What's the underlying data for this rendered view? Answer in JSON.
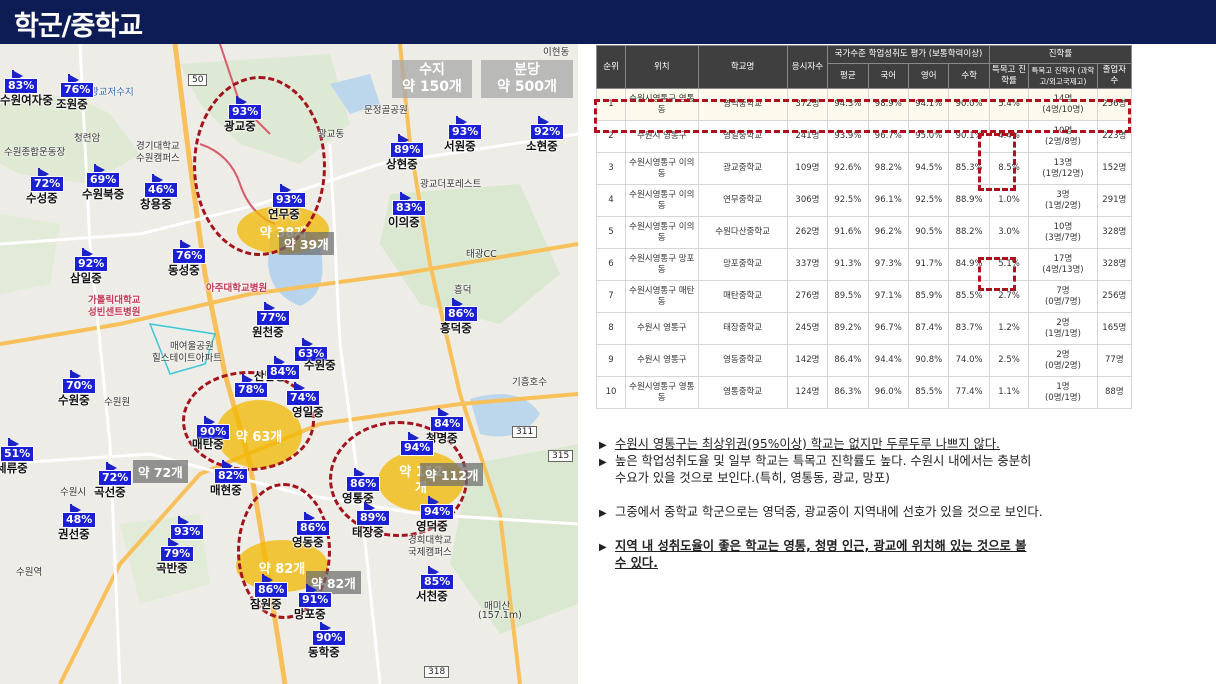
{
  "page": {
    "title": "학군/중학교"
  },
  "map": {
    "gray_counts": [
      {
        "id": "suji",
        "line1": "수지",
        "line2": "약 150개"
      },
      {
        "id": "bundang",
        "line1": "분당",
        "line2": "약 500개"
      },
      {
        "id": "c1",
        "text": "약 39개"
      },
      {
        "id": "c2",
        "text": "약 72개"
      },
      {
        "id": "c3",
        "text": "약 112개"
      },
      {
        "id": "c4",
        "text": "약 82개"
      }
    ],
    "blobs": [
      {
        "id": "b1",
        "text": "약 38개"
      },
      {
        "id": "b2",
        "text": "약 63개"
      },
      {
        "id": "b3",
        "line1": "약 112",
        "line2": "개"
      },
      {
        "id": "b4",
        "text": "약 82개"
      }
    ],
    "pins": [
      {
        "pct": "83%",
        "name": "수원여자중"
      },
      {
        "pct": "76%",
        "name": "조원중"
      },
      {
        "pct": "93%",
        "name": "광교중"
      },
      {
        "pct": "93%",
        "name": "서원중"
      },
      {
        "pct": "92%",
        "name": "소현중"
      },
      {
        "pct": "89%",
        "name": "상현중"
      },
      {
        "pct": "72%",
        "name": "수성중"
      },
      {
        "pct": "69%",
        "name": "수원북중"
      },
      {
        "pct": "46%",
        "name": "창용중"
      },
      {
        "pct": "93%",
        "name": "연무중"
      },
      {
        "pct": "83%",
        "name": "이의중"
      },
      {
        "pct": "92%",
        "name": "삼일중"
      },
      {
        "pct": "76%",
        "name": "동성중"
      },
      {
        "pct": "77%",
        "name": "원천중"
      },
      {
        "pct": "86%",
        "name": "흥덕중"
      },
      {
        "pct": "63%",
        "name": "수원중"
      },
      {
        "pct": "70%",
        "name": "수원중"
      },
      {
        "pct": "78%",
        "name": "산남중"
      },
      {
        "pct": "84%",
        "name": ""
      },
      {
        "pct": "74%",
        "name": "영일중"
      },
      {
        "pct": "90%",
        "name": "매탄중"
      },
      {
        "pct": "84%",
        "name": "청명중"
      },
      {
        "pct": "51%",
        "name": "세류중"
      },
      {
        "pct": "94%",
        "name": ""
      },
      {
        "pct": "72%",
        "name": "곡선중"
      },
      {
        "pct": "82%",
        "name": "매현중"
      },
      {
        "pct": "86%",
        "name": "영통중"
      },
      {
        "pct": "89%",
        "name": "태장중"
      },
      {
        "pct": "94%",
        "name": "영덕중"
      },
      {
        "pct": "48%",
        "name": "권선중"
      },
      {
        "pct": "93%",
        "name": ""
      },
      {
        "pct": "79%",
        "name": "곡반중"
      },
      {
        "pct": "86%",
        "name": "영동중"
      },
      {
        "pct": "85%",
        "name": "서천중"
      },
      {
        "pct": "86%",
        "name": "잠원중"
      },
      {
        "pct": "91%",
        "name": "망포중"
      },
      {
        "pct": "90%",
        "name": "동학중"
      }
    ],
    "labels": [
      {
        "id": "l1",
        "text": "경기대학교"
      },
      {
        "id": "l2",
        "text": "수원캠퍼스"
      },
      {
        "id": "l3",
        "text": "수원종합운동장"
      },
      {
        "id": "l4",
        "text": "청련암"
      },
      {
        "id": "l5",
        "text": "광교저수지"
      },
      {
        "id": "l6",
        "text": "광교동"
      },
      {
        "id": "l7",
        "text": "광교더포레스트"
      },
      {
        "id": "l8",
        "text": "태광CC"
      },
      {
        "id": "l9",
        "text": "가톨릭대학교"
      },
      {
        "id": "l10",
        "text": "성빈센트병원"
      },
      {
        "id": "l11",
        "text": "아주대학교병원"
      },
      {
        "id": "l12",
        "text": "매여울공원"
      },
      {
        "id": "l13",
        "text": "힐스테이트아파트"
      },
      {
        "id": "l14",
        "text": "경희대학교"
      },
      {
        "id": "l15",
        "text": "국제캠퍼스"
      },
      {
        "id": "l16",
        "text": "매미산"
      },
      {
        "id": "l17",
        "text": "(157.1m)"
      },
      {
        "id": "l18",
        "text": "수원시"
      },
      {
        "id": "l19",
        "text": "수원역"
      },
      {
        "id": "l20",
        "text": "수원원"
      },
      {
        "id": "l21",
        "text": "기흥호수"
      },
      {
        "id": "l22",
        "text": "흥덕"
      },
      {
        "id": "l23",
        "text": "이현동"
      },
      {
        "id": "l24",
        "text": "문정골공원"
      },
      {
        "id": "l25",
        "text": "315"
      },
      {
        "id": "l26",
        "text": "311"
      },
      {
        "id": "l27",
        "text": "318"
      },
      {
        "id": "l28",
        "text": "50"
      }
    ]
  },
  "table": {
    "headers": {
      "rank": "순위",
      "location": "위치",
      "school": "학교명",
      "applicants": "응시자수",
      "national_group": "국가수준 학업성취도 평가 (보통학력이상)",
      "avg": "평균",
      "korean": "국어",
      "english": "영어",
      "math": "수학",
      "advance_group": "진학률",
      "special_rate": "특목고 진학률",
      "special_count": "특목고 진학자 (과학고/외고국제고)",
      "grad": "졸업자 수"
    },
    "rows": [
      {
        "rank": "1",
        "loc": "수원시영통구 영통동",
        "school": "영덕중학교",
        "app": "372명",
        "avg": "94.3%",
        "kor": "98.9%",
        "eng": "94.1%",
        "math": "90.0%",
        "rate": "5.4%",
        "cnt1": "14명",
        "cnt2": "(4명/10명)",
        "grad": "256명"
      },
      {
        "rank": "2",
        "loc": "수원시 영통구",
        "school": "영일중학교",
        "app": "241명",
        "avg": "93.9%",
        "kor": "96.7%",
        "eng": "95.0%",
        "math": "90.1%",
        "rate": "4.4%",
        "cnt1": "10명",
        "cnt2": "(2명/8명)",
        "grad": "223명"
      },
      {
        "rank": "3",
        "loc": "수원시영통구 이의동",
        "school": "광교중학교",
        "app": "109명",
        "avg": "92.6%",
        "kor": "98.2%",
        "eng": "94.5%",
        "math": "85.3%",
        "rate": "8.5%",
        "cnt1": "13명",
        "cnt2": "(1명/12명)",
        "grad": "152명"
      },
      {
        "rank": "4",
        "loc": "수원시영통구 이의동",
        "school": "연무중학교",
        "app": "306명",
        "avg": "92.5%",
        "kor": "96.1%",
        "eng": "92.5%",
        "math": "88.9%",
        "rate": "1.0%",
        "cnt1": "3명",
        "cnt2": "(1명/2명)",
        "grad": "291명"
      },
      {
        "rank": "5",
        "loc": "수원시영통구 이의동",
        "school": "수원다산중학교",
        "app": "262명",
        "avg": "91.6%",
        "kor": "96.2%",
        "eng": "90.5%",
        "math": "88.2%",
        "rate": "3.0%",
        "cnt1": "10명",
        "cnt2": "(3명/7명)",
        "grad": "328명"
      },
      {
        "rank": "6",
        "loc": "수원시영통구 망포동",
        "school": "망포중학교",
        "app": "337명",
        "avg": "91.3%",
        "kor": "97.3%",
        "eng": "91.7%",
        "math": "84.9%",
        "rate": "5.1%",
        "cnt1": "17명",
        "cnt2": "(4명/13명)",
        "grad": "328명"
      },
      {
        "rank": "7",
        "loc": "수원시영통구 매탄동",
        "school": "매탄중학교",
        "app": "276명",
        "avg": "89.5%",
        "kor": "97.1%",
        "eng": "85.9%",
        "math": "85.5%",
        "rate": "2.7%",
        "cnt1": "7명",
        "cnt2": "(0명/7명)",
        "grad": "256명"
      },
      {
        "rank": "8",
        "loc": "수원시 영통구",
        "school": "태장중학교",
        "app": "245명",
        "avg": "89.2%",
        "kor": "96.7%",
        "eng": "87.4%",
        "math": "83.7%",
        "rate": "1.2%",
        "cnt1": "2명",
        "cnt2": "(1명/1명)",
        "grad": "165명"
      },
      {
        "rank": "9",
        "loc": "수원시 영통구",
        "school": "영동중학교",
        "app": "142명",
        "avg": "86.4%",
        "kor": "94.4%",
        "eng": "90.8%",
        "math": "74.0%",
        "rate": "2.5%",
        "cnt1": "2명",
        "cnt2": "(0명/2명)",
        "grad": "77명"
      },
      {
        "rank": "10",
        "loc": "수원시영통구 영통동",
        "school": "영통중학교",
        "app": "124명",
        "avg": "86.3%",
        "kor": "96.0%",
        "eng": "85.5%",
        "math": "77.4%",
        "rate": "1.1%",
        "cnt1": "1명",
        "cnt2": "(0명/1명)",
        "grad": "88명"
      }
    ]
  },
  "notes": {
    "arrow": "▶",
    "n1": "수원시 영통구는 최상위권(95%이상) 학교는 없지만 두루두루 나쁘지 않다.",
    "n2a": "높은 학업성취도율 및 일부 학교는 특목고 진학률도 높다. 수원시 내에서는 충분히",
    "n2b": "수요가 있을 것으로 보인다.(특히, 영통동, 광교, 망포)",
    "n3": "그중에서 중학교 학군으로는 영덕중, 광교중이 지역내에 선호가 있을 것으로 보인다.",
    "n4a": "지역 내 성취도율이 좋은 학교는 영통, 청명 인근, 광교에 위치해 있는 것으로 볼",
    "n4b": "수 있다."
  }
}
